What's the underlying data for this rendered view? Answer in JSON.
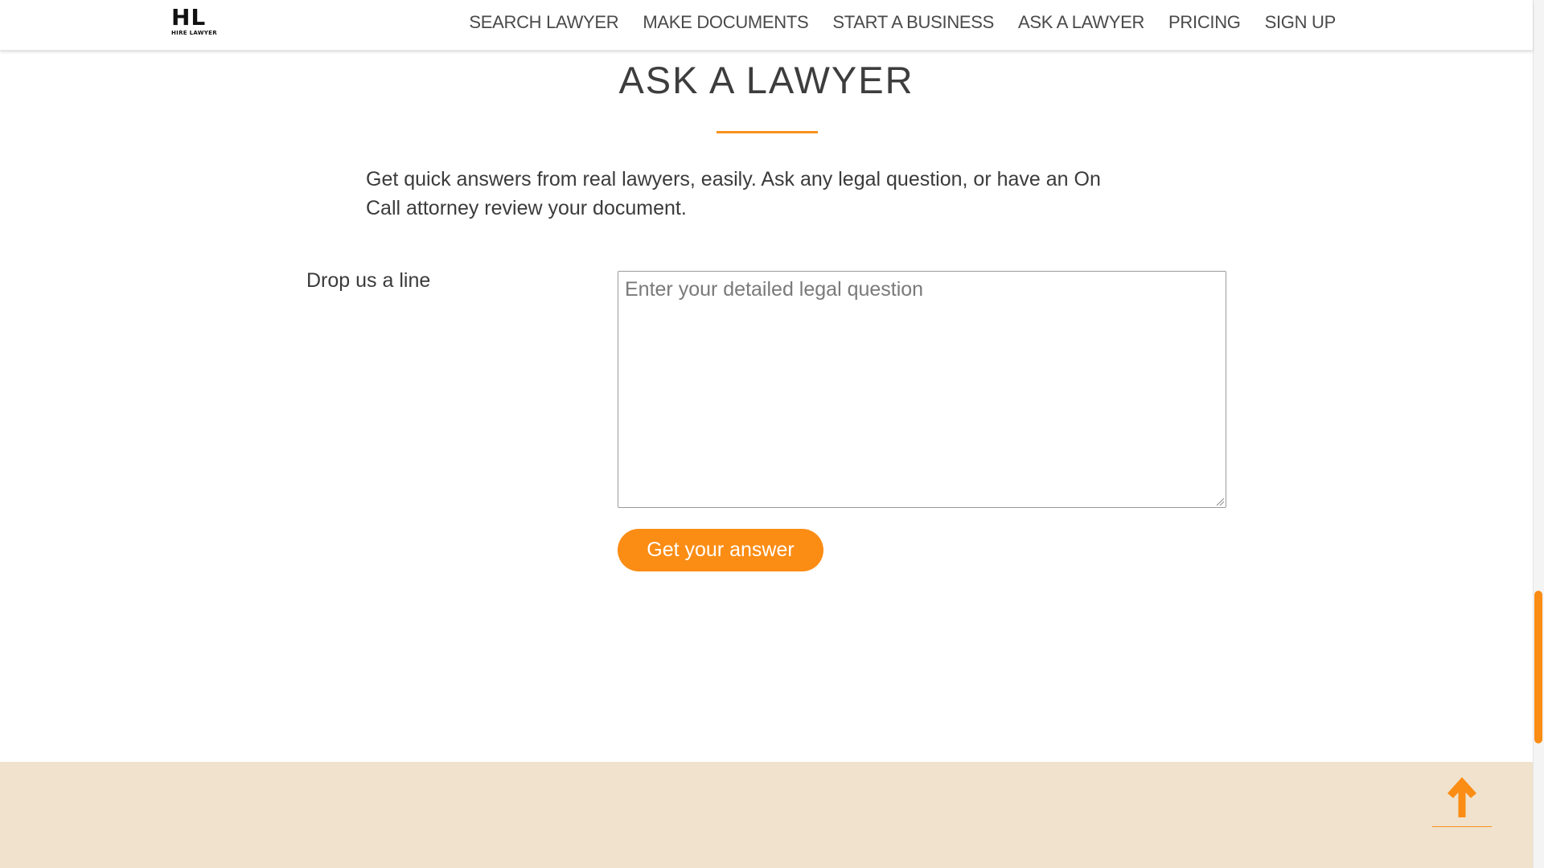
{
  "header": {
    "logo": {
      "mark": "HL",
      "subtitle": "HIRE LAWYER"
    },
    "nav": [
      {
        "label": "SEARCH LAWYER"
      },
      {
        "label": "MAKE DOCUMENTS"
      },
      {
        "label": "START A BUSINESS"
      },
      {
        "label": "ASK A LAWYER"
      },
      {
        "label": "PRICING"
      },
      {
        "label": "SIGN UP"
      }
    ]
  },
  "main": {
    "title": "ASK A LAWYER",
    "intro": "Get quick answers from real lawyers, easily. Ask any legal question, or have an On Call attorney review your document.",
    "form": {
      "label": "Drop us a line",
      "question": {
        "value": "",
        "placeholder": "Enter your detailed legal question"
      },
      "submit_label": "Get your answer"
    }
  },
  "footer": {
    "back_to_top_icon": "arrow-up-icon"
  },
  "colors": {
    "accent": "#fb8c14",
    "footer_bg": "#f0e2cc",
    "text": "#3b3b3b"
  },
  "scroll": {
    "position_fraction": 0.82
  }
}
